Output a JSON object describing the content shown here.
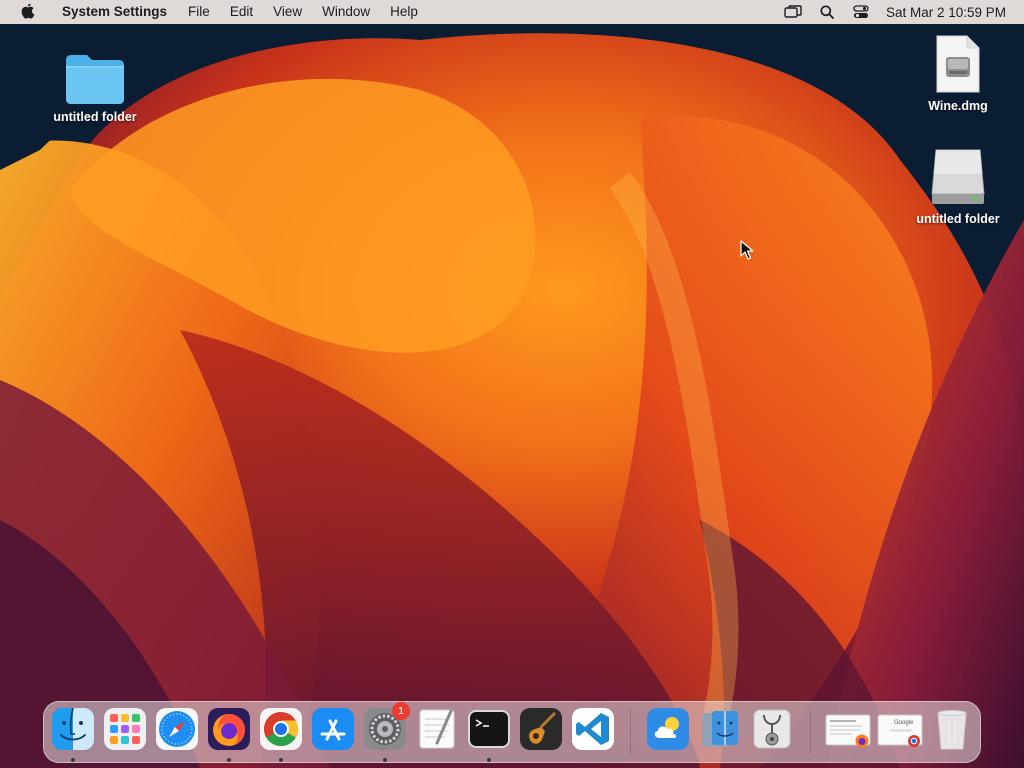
{
  "menubar": {
    "app_name": "System Settings",
    "items": [
      "File",
      "Edit",
      "View",
      "Window",
      "Help"
    ],
    "clock": "Sat Mar 2  10:59 PM"
  },
  "desktop": {
    "icons": [
      {
        "label": "untitled folder",
        "type": "folder"
      },
      {
        "label": "Wine.dmg",
        "type": "disk-image"
      },
      {
        "label": "untitled folder",
        "type": "external-drive"
      }
    ]
  },
  "dock": {
    "apps": [
      {
        "name": "Finder",
        "icon": "finder-icon",
        "running": true
      },
      {
        "name": "Launchpad",
        "icon": "launchpad-icon",
        "running": false
      },
      {
        "name": "Safari",
        "icon": "safari-icon",
        "running": false
      },
      {
        "name": "Firefox",
        "icon": "firefox-icon",
        "running": true
      },
      {
        "name": "Google Chrome",
        "icon": "chrome-icon",
        "running": true
      },
      {
        "name": "App Store",
        "icon": "app-store-icon",
        "running": false
      },
      {
        "name": "System Settings",
        "icon": "system-settings-icon",
        "running": true,
        "badge": "1"
      },
      {
        "name": "TextEdit",
        "icon": "textedit-icon",
        "running": false
      },
      {
        "name": "Terminal",
        "icon": "terminal-icon",
        "running": true
      },
      {
        "name": "GarageBand",
        "icon": "garageband-icon",
        "running": false
      },
      {
        "name": "Visual Studio Code",
        "icon": "vscode-icon",
        "running": false
      },
      {
        "name": "Weather",
        "icon": "weather-icon",
        "running": false
      },
      {
        "name": "Migration Assistant",
        "icon": "migration-assistant-icon",
        "running": false
      },
      {
        "name": "Disk Utility",
        "icon": "disk-utility-icon",
        "running": false
      }
    ],
    "minimized": [
      {
        "name": "Firefox window",
        "icon": "firefox-window-thumbnail"
      },
      {
        "name": "Chrome window",
        "icon": "chrome-window-thumbnail",
        "thumb_text": "Google"
      }
    ],
    "trash": {
      "name": "Trash",
      "icon": "trash-icon"
    }
  },
  "colors": {
    "menubar_bg": "#e8e2de",
    "wallpaper_dark": "#0b1d33",
    "wallpaper_orange": "#f07a1a",
    "wallpaper_red": "#c8321a",
    "wallpaper_purple": "#6a1c40",
    "badge_red": "#ee3b30"
  }
}
